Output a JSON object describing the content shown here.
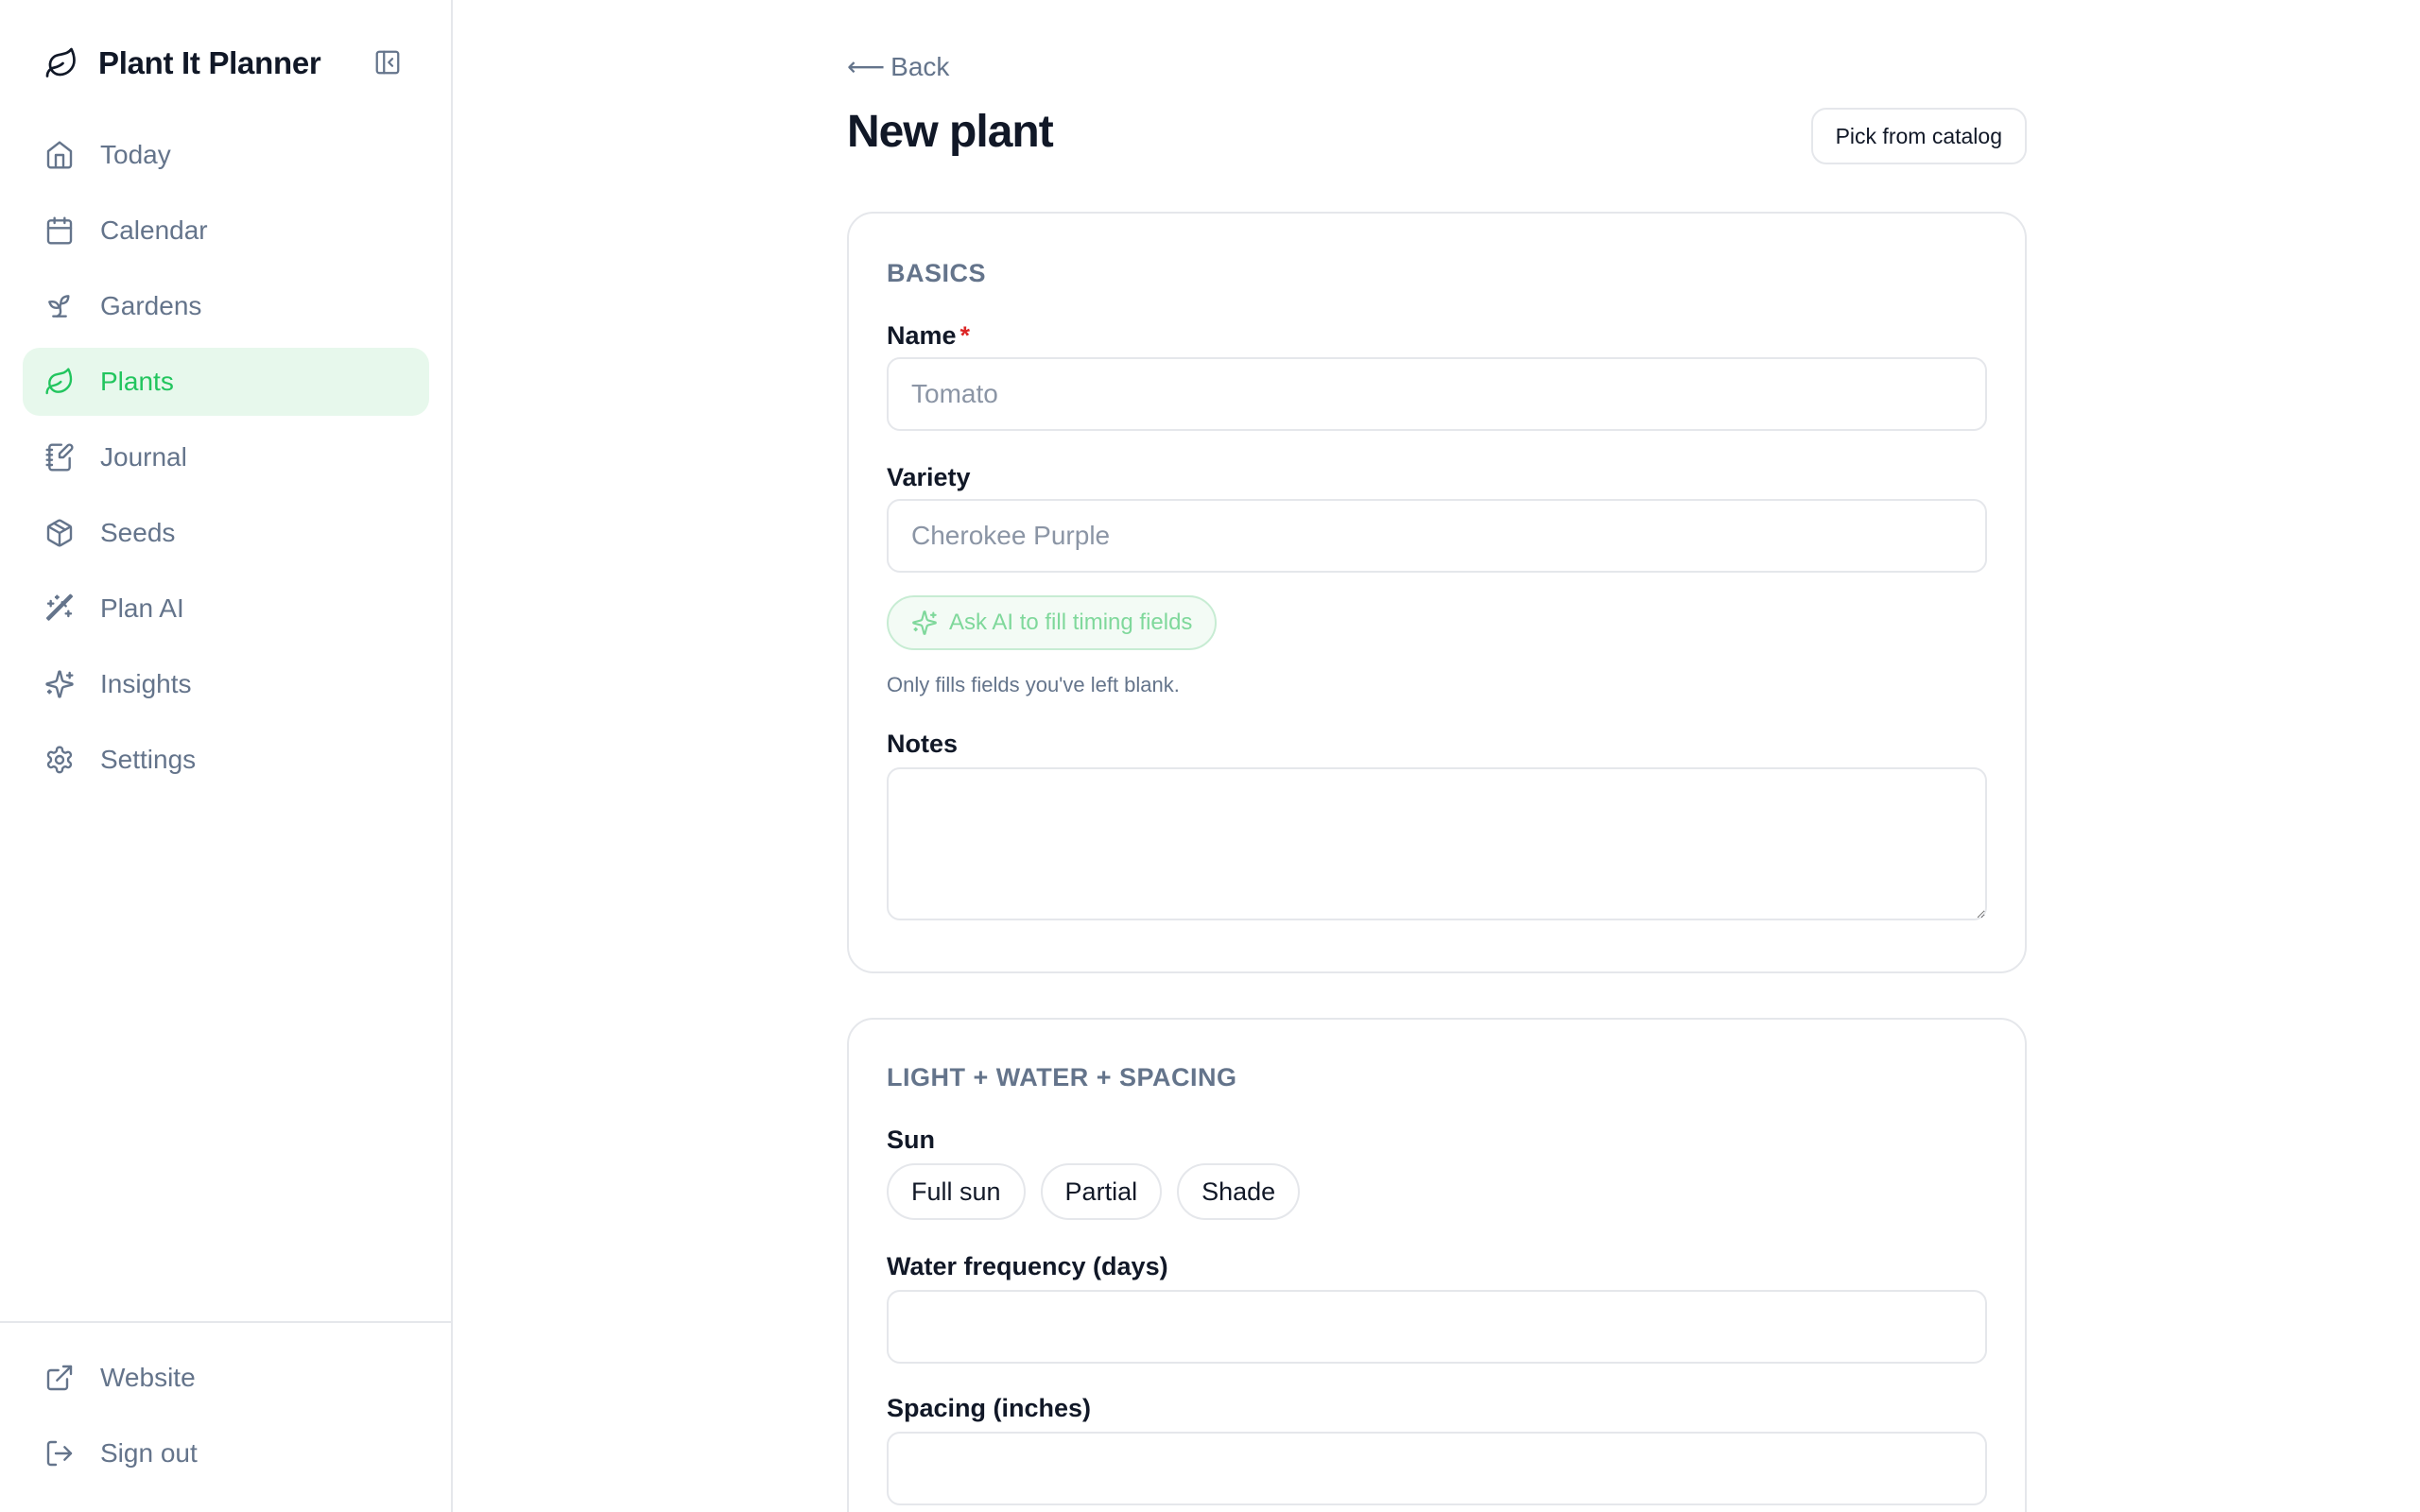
{
  "app": {
    "title": "Plant It Planner",
    "logo_icon": "leaf-icon",
    "collapse_icon": "panel-left-close-icon"
  },
  "sidebar": {
    "items": [
      {
        "label": "Today",
        "icon": "home-icon",
        "active": false
      },
      {
        "label": "Calendar",
        "icon": "calendar-icon",
        "active": false
      },
      {
        "label": "Gardens",
        "icon": "sprout-icon",
        "active": false
      },
      {
        "label": "Plants",
        "icon": "leaf-icon",
        "active": true
      },
      {
        "label": "Journal",
        "icon": "notebook-pen-icon",
        "active": false
      },
      {
        "label": "Seeds",
        "icon": "package-icon",
        "active": false
      },
      {
        "label": "Plan AI",
        "icon": "wand-icon",
        "active": false
      },
      {
        "label": "Insights",
        "icon": "sparkles-icon",
        "active": false
      },
      {
        "label": "Settings",
        "icon": "gear-icon",
        "active": false
      }
    ],
    "footer": [
      {
        "label": "Website",
        "icon": "external-link-icon"
      },
      {
        "label": "Sign out",
        "icon": "log-out-icon"
      }
    ]
  },
  "page": {
    "back_label": "Back",
    "back_arrow": "⟵",
    "title": "New plant",
    "catalog_button": "Pick from catalog"
  },
  "basics": {
    "section_title": "BASICS",
    "name_label": "Name",
    "name_required": "*",
    "name_placeholder": "Tomato",
    "name_value": "",
    "variety_label": "Variety",
    "variety_placeholder": "Cherokee Purple",
    "variety_value": "",
    "ai_button": "Ask AI to fill timing fields",
    "ai_hint": "Only fills fields you've left blank.",
    "notes_label": "Notes",
    "notes_value": ""
  },
  "light": {
    "section_title": "LIGHT + WATER + SPACING",
    "sun_label": "Sun",
    "sun_options": [
      "Full sun",
      "Partial",
      "Shade"
    ],
    "water_label": "Water frequency (days)",
    "water_value": "",
    "spacing_label": "Spacing (inches)",
    "spacing_value": ""
  },
  "colors": {
    "accent": "#22c55e",
    "active_bg": "#e7f8ec",
    "muted": "#64748b",
    "required": "#dc2626"
  }
}
